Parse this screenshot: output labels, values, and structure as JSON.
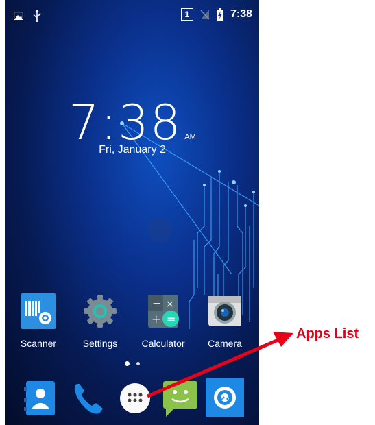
{
  "status_bar": {
    "sim_slot": "1",
    "time": "7:38",
    "icons": [
      "image-icon",
      "usb-icon",
      "sim-icon",
      "no-signal-icon",
      "battery-charging-icon"
    ]
  },
  "clock": {
    "time": "7:38",
    "ampm": "AM",
    "date": "Fri, January 2"
  },
  "home_apps": [
    {
      "label": "Scanner",
      "icon": "scanner-icon"
    },
    {
      "label": "Settings",
      "icon": "settings-gear-icon"
    },
    {
      "label": "Calculator",
      "icon": "calculator-icon"
    },
    {
      "label": "Camera",
      "icon": "camera-icon"
    }
  ],
  "dock": [
    {
      "icon": "contacts-icon"
    },
    {
      "icon": "phone-icon"
    },
    {
      "icon": "apps-list-icon"
    },
    {
      "icon": "messaging-icon"
    },
    {
      "icon": "browser-icon"
    }
  ],
  "annotation": {
    "label": "Apps List",
    "color": "#e8001a"
  }
}
